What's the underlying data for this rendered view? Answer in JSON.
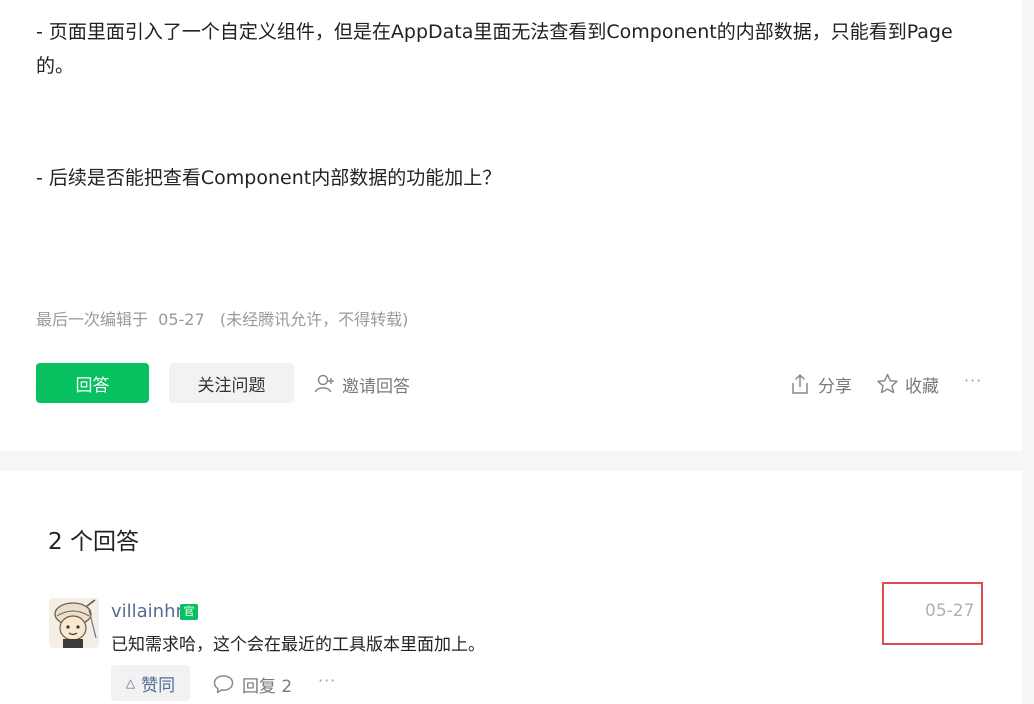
{
  "question": {
    "paragraph1": "- 页面里面引入了一个自定义组件，但是在AppData里面无法查看到Component的内部数据，只能看到Page的。",
    "paragraph2": "- 后续是否能把查看Component内部数据的功能加上？",
    "edit_meta": "最后一次编辑于  05-27   (未经腾讯允许，不得转载)"
  },
  "actions": {
    "answer_label": "回答",
    "follow_label": "关注问题",
    "invite_label": "邀请回答",
    "share_label": "分享",
    "collect_label": "收藏",
    "more_label": "···"
  },
  "answers": {
    "count_label": "2 个回答",
    "items": [
      {
        "username": "villainhr",
        "badge": "官",
        "content": "已知需求哈，这个会在最近的工具版本里面加上。",
        "date": "05-27",
        "like_label": "赞同",
        "reply_label": "回复 2",
        "more_label": "···"
      }
    ]
  },
  "colors": {
    "primary": "#07c160",
    "link": "#576b95",
    "highlight_border": "#e24b4b"
  }
}
